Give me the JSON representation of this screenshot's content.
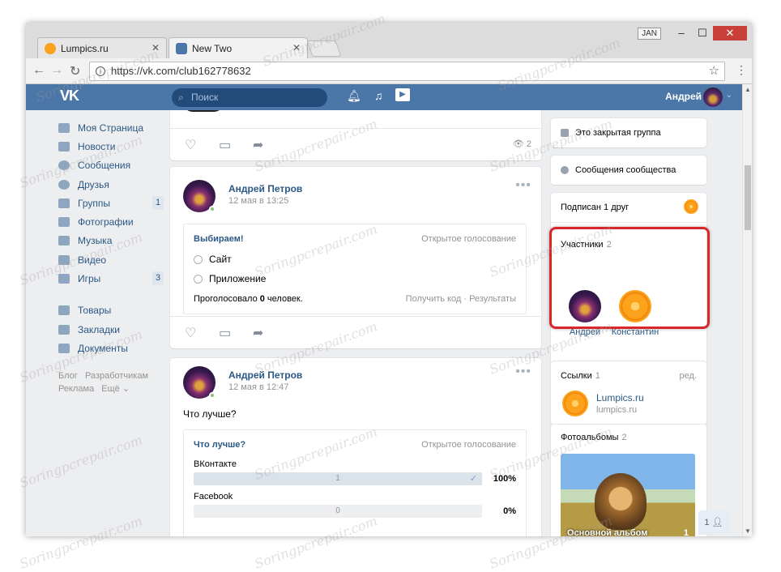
{
  "browser": {
    "tabs": [
      {
        "label": "Lumpics.ru",
        "fav_color": "#fca21d"
      },
      {
        "label": "New Two",
        "fav_color": "#4a76a8"
      }
    ],
    "profile_badge": "JAN",
    "url": "https://vk.com/club162778632",
    "window_buttons": {
      "minimize": "–",
      "maximize": "☐",
      "close": "✕"
    }
  },
  "vk": {
    "logo": "VK",
    "search_placeholder": "Поиск",
    "user_name": "Андрей",
    "accent": "#4a76a8"
  },
  "leftnav": {
    "items": [
      {
        "label": "Моя Страница",
        "icon": "home-icon"
      },
      {
        "label": "Новости",
        "icon": "news-icon"
      },
      {
        "label": "Сообщения",
        "icon": "messages-icon"
      },
      {
        "label": "Друзья",
        "icon": "friends-icon"
      },
      {
        "label": "Группы",
        "icon": "groups-icon",
        "count": "1"
      },
      {
        "label": "Фотографии",
        "icon": "camera-icon"
      },
      {
        "label": "Музыка",
        "icon": "music-icon"
      },
      {
        "label": "Видео",
        "icon": "video-icon"
      },
      {
        "label": "Игры",
        "icon": "games-icon",
        "count": "3"
      },
      {
        "label": "Товары",
        "icon": "bag-icon"
      },
      {
        "label": "Закладки",
        "icon": "star-icon"
      },
      {
        "label": "Документы",
        "icon": "document-icon"
      }
    ],
    "footer": {
      "blog": "Блог",
      "dev": "Разработчикам",
      "ads": "Реклама",
      "more": "Ещё ⌄"
    }
  },
  "feed": {
    "top_views": "2",
    "post1": {
      "author": "Андрей Петров",
      "date": "12 мая в 13:25",
      "poll": {
        "title": "Выбираем!",
        "type": "Открытое голосование",
        "options": [
          "Сайт",
          "Приложение"
        ],
        "voted_prefix": "Проголосовало ",
        "voted_count": "0",
        "voted_suffix": " человек.",
        "links": "Получить код · Результаты"
      }
    },
    "post2": {
      "author": "Андрей Петров",
      "date": "12 мая в 12:47",
      "text": "Что лучше?",
      "poll": {
        "title": "Что лучше?",
        "type": "Открытое голосование",
        "results": [
          {
            "label": "ВКонтакте",
            "votes": "1",
            "percent": "100%",
            "fill": 1.0,
            "checked": "✓"
          },
          {
            "label": "Facebook",
            "votes": "0",
            "percent": "0%",
            "fill": 0.0,
            "checked": ""
          }
        ]
      }
    }
  },
  "right": {
    "closed_group": "Это закрытая группа",
    "community_messages": "Сообщения сообщества",
    "subscribed": "Подписан 1 друг",
    "members_title": "Участники",
    "members_count": "2",
    "members": [
      {
        "name": "Андрей"
      },
      {
        "name": "Константин"
      }
    ],
    "links_title": "Ссылки",
    "links_count": "1",
    "links_edit": "ред.",
    "link": {
      "title": "Lumpics.ru",
      "sub": "lumpics.ru"
    },
    "albums_title": "Фотоальбомы",
    "albums_count": "2",
    "album": {
      "caption": "Основной альбом",
      "count": "1"
    },
    "chat_count": "1"
  },
  "watermark": "Soringpcrepair.com"
}
